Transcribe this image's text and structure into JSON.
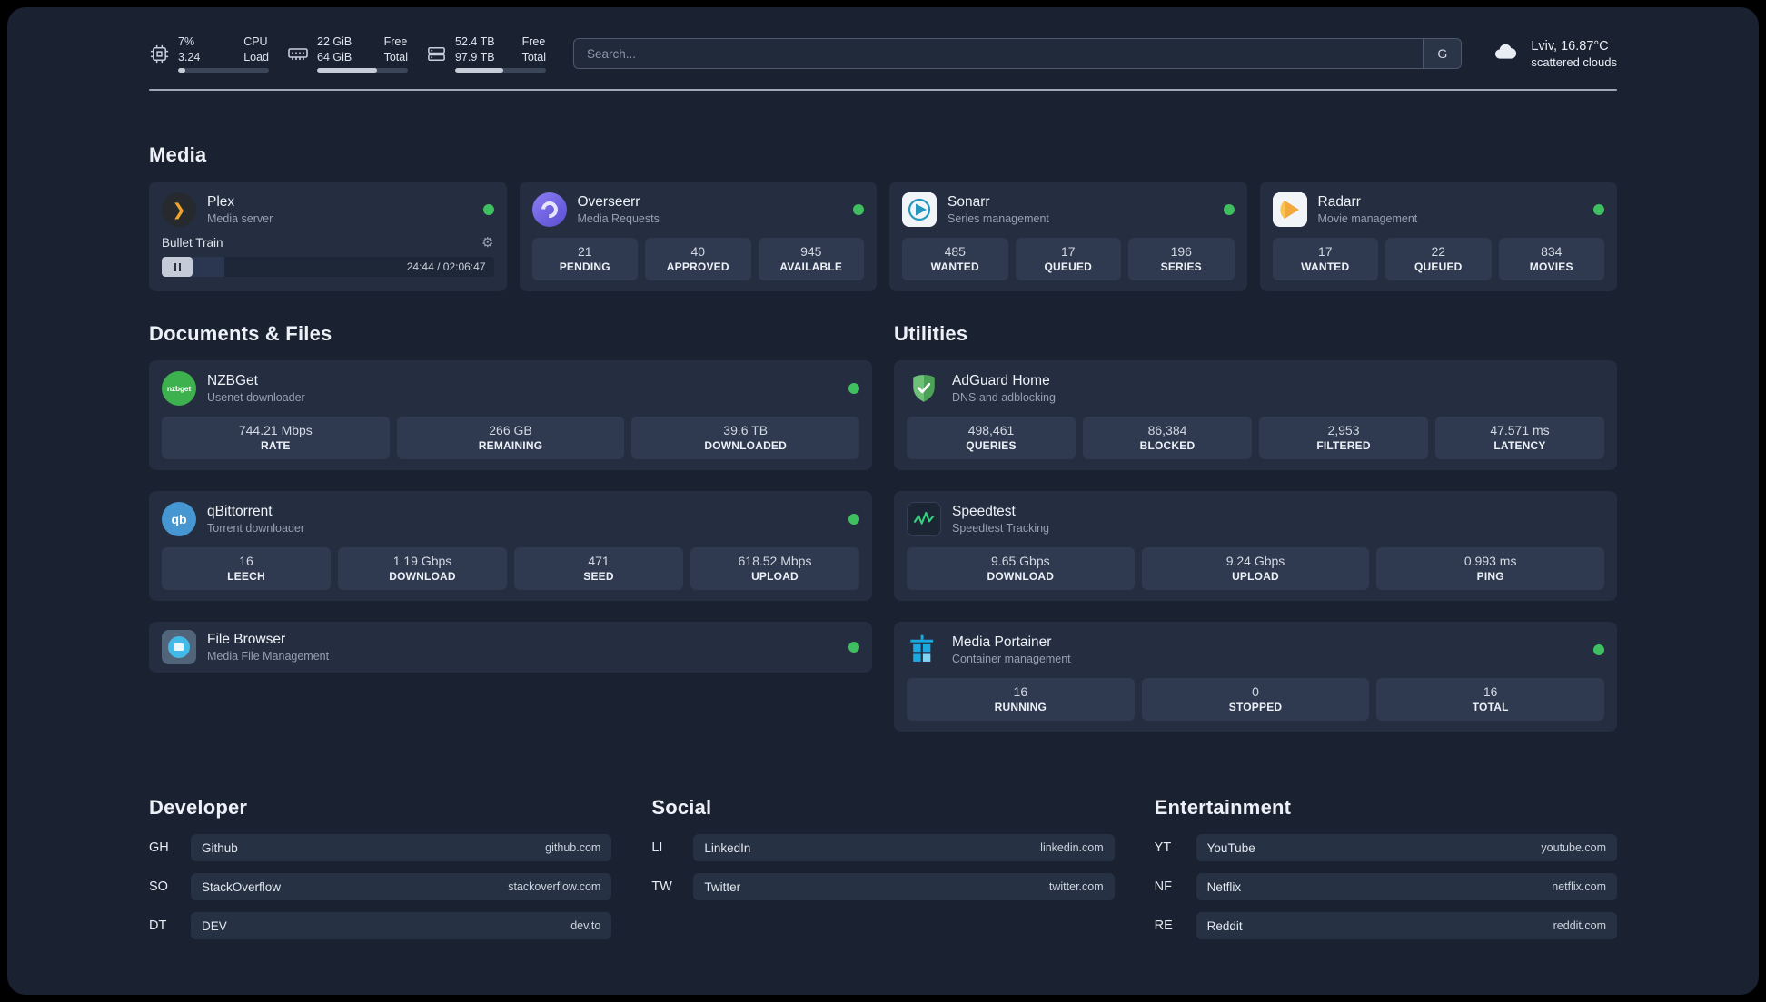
{
  "topbar": {
    "cpu": {
      "line1": "7%",
      "line2": "3.24",
      "label1": "CPU",
      "label2": "Load",
      "progress": 8
    },
    "ram": {
      "line1": "22 GiB",
      "line2": "64 GiB",
      "label1": "Free",
      "label2": "Total",
      "progress": 66
    },
    "disk": {
      "line1": "52.4 TB",
      "line2": "97.9 TB",
      "label1": "Free",
      "label2": "Total",
      "progress": 53
    },
    "search": {
      "placeholder": "Search...",
      "engine": "G"
    },
    "weather": {
      "location": "Lviv, 16.87°C",
      "condition": "scattered clouds"
    }
  },
  "sections": {
    "media": "Media",
    "documents": "Documents & Files",
    "utilities": "Utilities",
    "developer": "Developer",
    "social": "Social",
    "entertainment": "Entertainment"
  },
  "plex": {
    "name": "Plex",
    "subtitle": "Media server",
    "now_playing": "Bullet Train",
    "time": "24:44 / 02:06:47",
    "progress": 19
  },
  "overseerr": {
    "name": "Overseerr",
    "subtitle": "Media Requests",
    "stats": [
      {
        "value": "21",
        "label": "PENDING"
      },
      {
        "value": "40",
        "label": "APPROVED"
      },
      {
        "value": "945",
        "label": "AVAILABLE"
      }
    ]
  },
  "sonarr": {
    "name": "Sonarr",
    "subtitle": "Series management",
    "stats": [
      {
        "value": "485",
        "label": "WANTED"
      },
      {
        "value": "17",
        "label": "QUEUED"
      },
      {
        "value": "196",
        "label": "SERIES"
      }
    ]
  },
  "radarr": {
    "name": "Radarr",
    "subtitle": "Movie management",
    "stats": [
      {
        "value": "17",
        "label": "WANTED"
      },
      {
        "value": "22",
        "label": "QUEUED"
      },
      {
        "value": "834",
        "label": "MOVIES"
      }
    ]
  },
  "nzbget": {
    "name": "NZBGet",
    "subtitle": "Usenet downloader",
    "stats": [
      {
        "value": "744.21 Mbps",
        "label": "RATE"
      },
      {
        "value": "266 GB",
        "label": "REMAINING"
      },
      {
        "value": "39.6 TB",
        "label": "DOWNLOADED"
      }
    ]
  },
  "qbittorrent": {
    "name": "qBittorrent",
    "subtitle": "Torrent downloader",
    "stats": [
      {
        "value": "16",
        "label": "LEECH"
      },
      {
        "value": "1.19 Gbps",
        "label": "DOWNLOAD"
      },
      {
        "value": "471",
        "label": "SEED"
      },
      {
        "value": "618.52 Mbps",
        "label": "UPLOAD"
      }
    ]
  },
  "filebrowser": {
    "name": "File Browser",
    "subtitle": "Media File Management"
  },
  "adguard": {
    "name": "AdGuard Home",
    "subtitle": "DNS and adblocking",
    "stats": [
      {
        "value": "498,461",
        "label": "QUERIES"
      },
      {
        "value": "86,384",
        "label": "BLOCKED"
      },
      {
        "value": "2,953",
        "label": "FILTERED"
      },
      {
        "value": "47.571 ms",
        "label": "LATENCY"
      }
    ]
  },
  "speedtest": {
    "name": "Speedtest",
    "subtitle": "Speedtest Tracking",
    "stats": [
      {
        "value": "9.65 Gbps",
        "label": "DOWNLOAD"
      },
      {
        "value": "9.24 Gbps",
        "label": "UPLOAD"
      },
      {
        "value": "0.993 ms",
        "label": "PING"
      }
    ]
  },
  "portainer": {
    "name": "Media Portainer",
    "subtitle": "Container management",
    "stats": [
      {
        "value": "16",
        "label": "RUNNING"
      },
      {
        "value": "0",
        "label": "STOPPED"
      },
      {
        "value": "16",
        "label": "TOTAL"
      }
    ]
  },
  "bookmarks": {
    "developer": [
      {
        "abbr": "GH",
        "name": "Github",
        "url": "github.com"
      },
      {
        "abbr": "SO",
        "name": "StackOverflow",
        "url": "stackoverflow.com"
      },
      {
        "abbr": "DT",
        "name": "DEV",
        "url": "dev.to"
      }
    ],
    "social": [
      {
        "abbr": "LI",
        "name": "LinkedIn",
        "url": "linkedin.com"
      },
      {
        "abbr": "TW",
        "name": "Twitter",
        "url": "twitter.com"
      }
    ],
    "entertainment": [
      {
        "abbr": "YT",
        "name": "YouTube",
        "url": "youtube.com"
      },
      {
        "abbr": "NF",
        "name": "Netflix",
        "url": "netflix.com"
      },
      {
        "abbr": "RE",
        "name": "Reddit",
        "url": "reddit.com"
      }
    ]
  },
  "icons": {
    "gear": "⚙",
    "plex_chevron": "❯",
    "qb": "qb",
    "nzbget": "nzbget"
  },
  "colors": {
    "status_online": "#3fbf5f",
    "plex_gold": "#f0a42c",
    "overseerr_purple": "#6a5cd9",
    "sonarr_blue": "#2596be",
    "radarr_orange": "#f2a93b",
    "nzbget_green": "#3db14d",
    "qbittorrent_blue": "#4596d1",
    "adguard_green": "#5fb86a",
    "speedtest_green": "#35d07f",
    "portainer_blue": "#1ca8e0"
  }
}
